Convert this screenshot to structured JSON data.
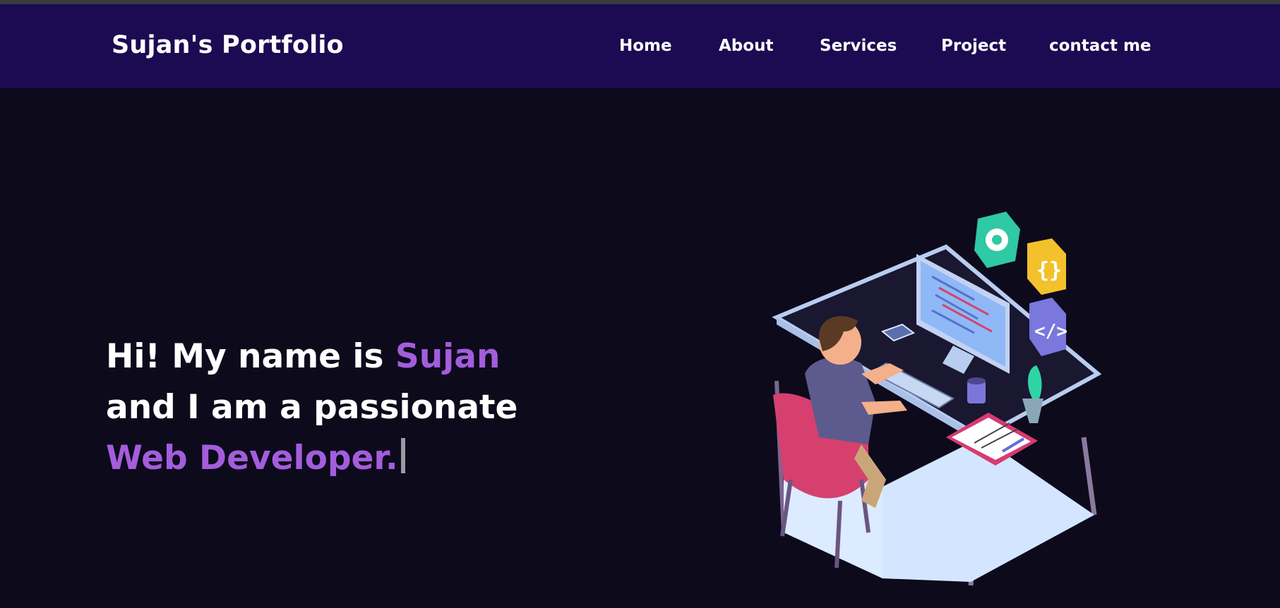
{
  "header": {
    "brand": "Sujan's Portfolio",
    "nav": [
      {
        "label": "Home"
      },
      {
        "label": "About"
      },
      {
        "label": "Services"
      },
      {
        "label": "Project"
      },
      {
        "label": "contact me"
      }
    ]
  },
  "hero": {
    "line1_prefix": "Hi! My name is ",
    "name": "Sujan",
    "line2": "and I am a passionate",
    "role": "Web Developer."
  },
  "colors": {
    "nav_background": "#1c0b52",
    "page_background": "#0d0a1c",
    "accent": "#a35ddd"
  },
  "illustration": {
    "subject": "developer-at-desk-illustration",
    "icons": [
      "gear-icon",
      "curly-braces-icon",
      "code-tag-icon"
    ]
  }
}
